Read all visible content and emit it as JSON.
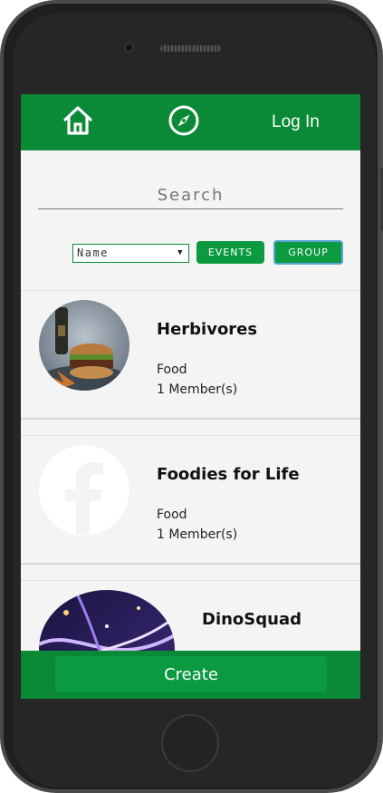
{
  "nav": {
    "login_label": "Log In"
  },
  "search": {
    "placeholder": "Search"
  },
  "filters": {
    "select_value": "Name",
    "events_label": "EVENTS",
    "group_label": "GROUP"
  },
  "groups": [
    {
      "title": "Herbivores",
      "category": "Food",
      "members": "1 Member(s)"
    },
    {
      "title": "Foodies for Life",
      "category": "Food",
      "members": "1 Member(s)"
    },
    {
      "title": "DinoSquad",
      "category": "",
      "members": ""
    }
  ],
  "footer": {
    "create_label": "Create"
  },
  "colors": {
    "primary": "#0a8a37",
    "button": "#0b9a40",
    "background": "#f4f4f4"
  },
  "icons": {
    "home": "home-icon",
    "compass": "compass-icon",
    "facebook": "facebook-icon"
  }
}
